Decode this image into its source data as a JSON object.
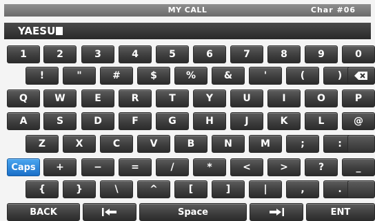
{
  "title": "MY CALL",
  "char_counter": "Char #06",
  "entry": {
    "value": "YAESU"
  },
  "rows": [
    [
      "1",
      "2",
      "3",
      "4",
      "5",
      "6",
      "7",
      "8",
      "9",
      "0"
    ],
    [
      "!",
      "\"",
      "#",
      "$",
      "%",
      "&",
      "'",
      "(",
      ")"
    ],
    [
      "Q",
      "W",
      "E",
      "R",
      "T",
      "Y",
      "U",
      "I",
      "O",
      "P"
    ],
    [
      "A",
      "S",
      "D",
      "F",
      "G",
      "H",
      "J",
      "K",
      "L",
      "@"
    ],
    [
      "Z",
      "X",
      "C",
      "V",
      "B",
      "N",
      "M",
      ";",
      ":"
    ],
    [
      "Caps",
      "+",
      "−",
      "=",
      "/",
      "*",
      "<",
      ">",
      "?",
      "_"
    ],
    [
      "{",
      "}",
      "\\",
      "^",
      "[",
      "]",
      "|",
      ",",
      "."
    ]
  ],
  "bottom": {
    "back": "BACK",
    "space": "Space",
    "ent": "ENT"
  },
  "icons": {
    "backspace": "backspace-icon",
    "cursor_left": "cursor-left-icon",
    "cursor_right": "cursor-right-icon"
  },
  "colors": {
    "caps_active": "#1a6fc8",
    "key": "#3e3e3e",
    "title_bar": "#7a7a7a"
  }
}
